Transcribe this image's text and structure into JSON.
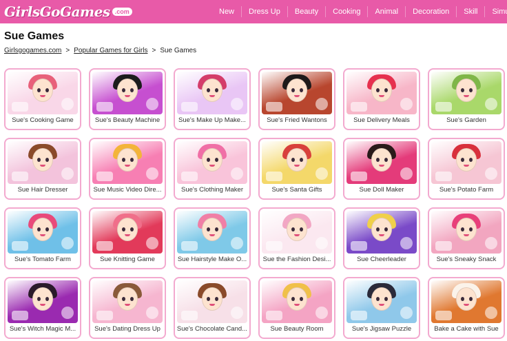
{
  "header": {
    "logo_text": "GirlsGoGames",
    "logo_suffix": ".com",
    "nav": [
      "New",
      "Dress Up",
      "Beauty",
      "Cooking",
      "Animal",
      "Decoration",
      "Skill",
      "Simu"
    ]
  },
  "page_title": "Sue Games",
  "breadcrumb": {
    "home": "Girlsgogames.com",
    "sep1": ">",
    "section": "Popular Games for Girls",
    "sep2": ">",
    "current": "Sue Games"
  },
  "games": [
    {
      "title": "Sue's Cooking Game",
      "color": "#f9d7e8",
      "hair": "#e8607a"
    },
    {
      "title": "Sue's Beauty Machine",
      "color": "#c64fd0",
      "hair": "#1c1c1c"
    },
    {
      "title": "Sue's Make Up Make...",
      "color": "#e9c6f5",
      "hair": "#d43d6a"
    },
    {
      "title": "Sue's Fried Wantons",
      "color": "#b8462e",
      "hair": "#1e1a1a"
    },
    {
      "title": "Sue Delivery Meals",
      "color": "#f7b6c8",
      "hair": "#e6304e"
    },
    {
      "title": "Sue's Garden",
      "color": "#a9d86a",
      "hair": "#7fb648"
    },
    {
      "title": "Sue Hair Dresser",
      "color": "#f3c3dc",
      "hair": "#8a4a2a"
    },
    {
      "title": "Sue Music Video Dire...",
      "color": "#f77fb3",
      "hair": "#f3b43a"
    },
    {
      "title": "Sue's Clothing Maker",
      "color": "#f9c4da",
      "hair": "#f06fa6"
    },
    {
      "title": "Sue's Santa Gifts",
      "color": "#f4d86a",
      "hair": "#d8403b"
    },
    {
      "title": "Sue Doll Maker",
      "color": "#e43b7a",
      "hair": "#2a1a1a"
    },
    {
      "title": "Sue's Potato Farm",
      "color": "#f6c6d4",
      "hair": "#d8303c"
    },
    {
      "title": "Sue's Tomato Farm",
      "color": "#6fc0e8",
      "hair": "#e84a7a"
    },
    {
      "title": "Sue Knitting Game",
      "color": "#e23a5a",
      "hair": "#f06f8a"
    },
    {
      "title": "Sue Hairstyle Make O...",
      "color": "#7fc9e8",
      "hair": "#f07fa6"
    },
    {
      "title": "Sue the Fashion Desi...",
      "color": "#fbe8f0",
      "hair": "#f2a7c4"
    },
    {
      "title": "Sue Cheerleader",
      "color": "#7a4ac8",
      "hair": "#f0d04a"
    },
    {
      "title": "Sue's Sneaky Snack",
      "color": "#f2a6c0",
      "hair": "#e8407a"
    },
    {
      "title": "Sue's Witch Magic M...",
      "color": "#9a2ab0",
      "hair": "#2a1a2a"
    },
    {
      "title": "Sue's Dating Dress Up",
      "color": "#f6b6d0",
      "hair": "#8a5a3a"
    },
    {
      "title": "Sue's Chocolate Cand...",
      "color": "#f7e0e8",
      "hair": "#8a4a2a"
    },
    {
      "title": "Sue Beauty Room",
      "color": "#f4a4c4",
      "hair": "#f0c04a"
    },
    {
      "title": "Sue's Jigsaw Puzzle",
      "color": "#8fc8ea",
      "hair": "#2a2a3a"
    },
    {
      "title": "Bake a Cake with Sue",
      "color": "#e07830",
      "hair": "#fbf3ea"
    }
  ]
}
